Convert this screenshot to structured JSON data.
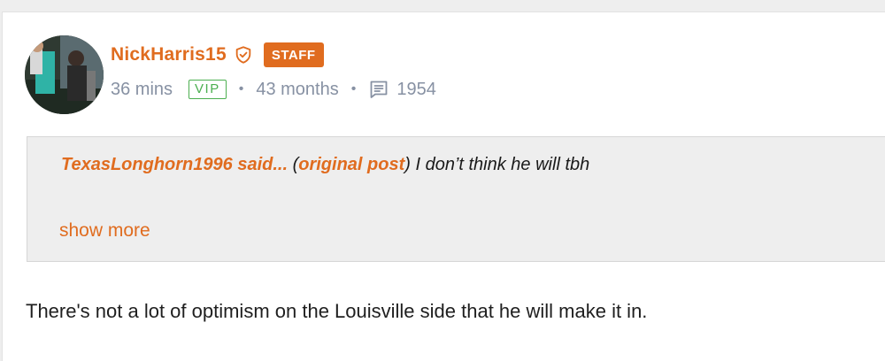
{
  "author": {
    "username": "NickHarris15",
    "staff_label": "STAFF",
    "post_age": "36 mins",
    "vip_label": "VIP",
    "membership": "43 months",
    "post_count": "1954"
  },
  "quote": {
    "quoted_user_said": "TexasLonghorn1996 said...",
    "open_paren": " (",
    "original_post_label": "original post",
    "close_paren": ")",
    "text": " I don’t think he will tbh",
    "show_more_label": "show more"
  },
  "post": {
    "body": "There's not a lot of optimism on the Louisville side that he will make it in."
  },
  "icons": {
    "verified": "shield-check-icon",
    "posts": "message-square-icon"
  },
  "colors": {
    "accent": "#e06c1f",
    "vip": "#4caf50",
    "meta": "#8791a3",
    "quote_bg": "#eeeeee"
  }
}
